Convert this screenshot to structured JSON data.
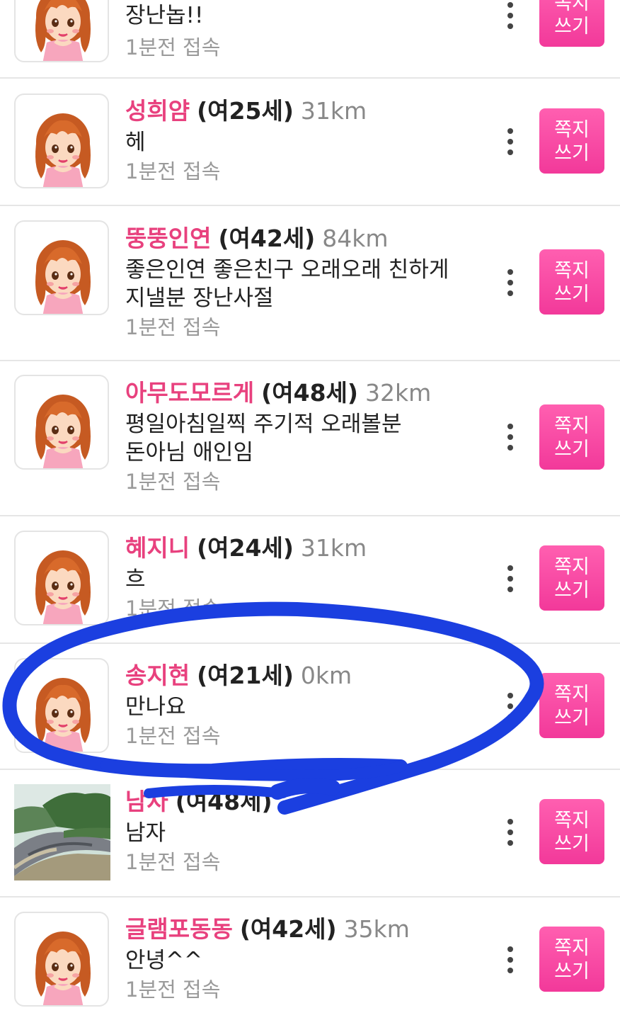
{
  "rows": [
    {
      "nick": "",
      "age": "",
      "dist": "",
      "msg1": "장난놉!!",
      "msg2": "",
      "seen": "1분전 접속",
      "btn1": "쪽지",
      "btn2": "쓰기"
    },
    {
      "nick": "성희얌",
      "age": "(여25세)",
      "dist": "31km",
      "msg1": "헤",
      "msg2": "",
      "seen": "1분전 접속",
      "btn1": "쪽지",
      "btn2": "쓰기"
    },
    {
      "nick": "뚱뚱인연",
      "age": "(여42세)",
      "dist": "84km",
      "msg1": "좋은인연 좋은친구  오래오래 친하게",
      "msg2": "지낼분 장난사절",
      "seen": "1분전 접속",
      "btn1": "쪽지",
      "btn2": "쓰기"
    },
    {
      "nick": "아무도모르게",
      "age": "(여48세)",
      "dist": "32km",
      "msg1": "평일아침일찍 주기적 오래볼분",
      "msg2": "돈아님 애인임",
      "seen": "1분전 접속",
      "btn1": "쪽지",
      "btn2": "쓰기"
    },
    {
      "nick": "혜지니",
      "age": "(여24세)",
      "dist": "31km",
      "msg1": "흐",
      "msg2": "",
      "seen": "1분전 접속",
      "btn1": "쪽지",
      "btn2": "쓰기"
    },
    {
      "nick": "송지현",
      "age": "(여21세)",
      "dist": "0km",
      "msg1": "만나요",
      "msg2": "",
      "seen": "1분전 접속",
      "btn1": "쪽지",
      "btn2": "쓰기"
    },
    {
      "nick": "남자",
      "age": "(여48세)",
      "dist": "",
      "msg1": "남자",
      "msg2": "",
      "seen": "1분전 접속",
      "btn1": "쪽지",
      "btn2": "쓰기"
    },
    {
      "nick": "글램포동동",
      "age": "(여42세)",
      "dist": "35km",
      "msg1": "안녕^^",
      "msg2": "",
      "seen": "1분전 접속",
      "btn1": "쪽지",
      "btn2": "쓰기"
    }
  ],
  "colors": {
    "accent": "#e8417e",
    "button": "#f2399a",
    "annotation": "#1b3fe0"
  },
  "icons": {
    "avatar": "cartoon-girl-avatar-icon",
    "more": "more-vertical-icon"
  }
}
